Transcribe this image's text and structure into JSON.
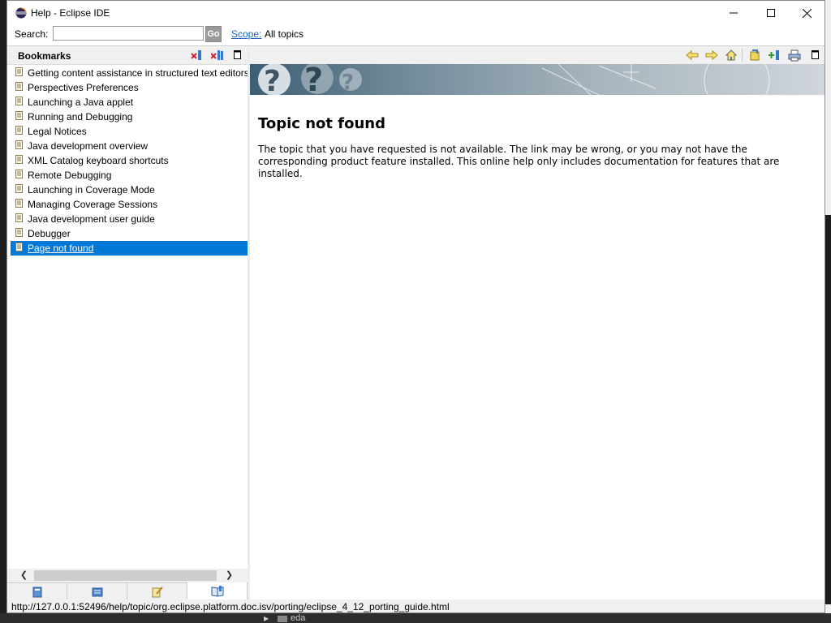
{
  "window": {
    "title": "Help - Eclipse IDE"
  },
  "search": {
    "label": "Search:",
    "value": "",
    "go_label": "Go",
    "scope_label": "Scope:",
    "scope_value": "All topics"
  },
  "bookmarks": {
    "title": "Bookmarks",
    "items": [
      {
        "label": "Getting content assistance in structured text editors"
      },
      {
        "label": "Perspectives Preferences"
      },
      {
        "label": "Launching a Java applet"
      },
      {
        "label": "Running and Debugging"
      },
      {
        "label": "Legal Notices"
      },
      {
        "label": "Java development overview"
      },
      {
        "label": "XML Catalog keyboard shortcuts"
      },
      {
        "label": "Remote Debugging"
      },
      {
        "label": "Launching in Coverage Mode"
      },
      {
        "label": "Managing Coverage Sessions"
      },
      {
        "label": "Java development user guide"
      },
      {
        "label": "Debugger"
      },
      {
        "label": "Page not found",
        "selected": true
      }
    ]
  },
  "content": {
    "heading": "Topic not found",
    "body": "The topic that you have requested is not available. The link may be wrong, or you may not have the corresponding product feature installed. This online help only includes documentation for features that are installed."
  },
  "status": {
    "url": "http://127.0.0.1:52496/help/topic/org.eclipse.platform.doc.isv/porting/eclipse_4_12_porting_guide.html"
  },
  "background_app": {
    "folder_label": "eda"
  },
  "colors": {
    "selection": "#0078d7",
    "link": "#1a66c2"
  }
}
